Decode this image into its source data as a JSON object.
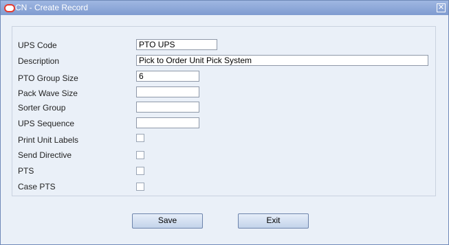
{
  "window": {
    "title": "CN - Create Record",
    "close_glyph": "✕"
  },
  "form": {
    "ups_code": {
      "label": "UPS Code",
      "value": "PTO UPS"
    },
    "description": {
      "label": "Description",
      "value": "Pick to Order Unit Pick System"
    },
    "pto_group_size": {
      "label": "PTO Group Size",
      "value": "6"
    },
    "pack_wave_size": {
      "label": "Pack Wave Size",
      "value": ""
    },
    "sorter_group": {
      "label": "Sorter Group",
      "value": ""
    },
    "ups_sequence": {
      "label": "UPS Sequence",
      "value": ""
    },
    "print_unit_labels": {
      "label": "Print Unit Labels",
      "checked": false
    },
    "send_directive": {
      "label": "Send Directive",
      "checked": false
    },
    "pts": {
      "label": "PTS",
      "checked": false
    },
    "case_pts": {
      "label": "Case PTS",
      "checked": false
    }
  },
  "buttons": {
    "save": "Save",
    "exit": "Exit"
  },
  "colors": {
    "titlebar": "#8fa9d8",
    "background": "#eaf0f8",
    "logo": "#e63a2e"
  },
  "icons": {
    "app_logo": "oracle-logo-icon",
    "close": "close-icon"
  }
}
